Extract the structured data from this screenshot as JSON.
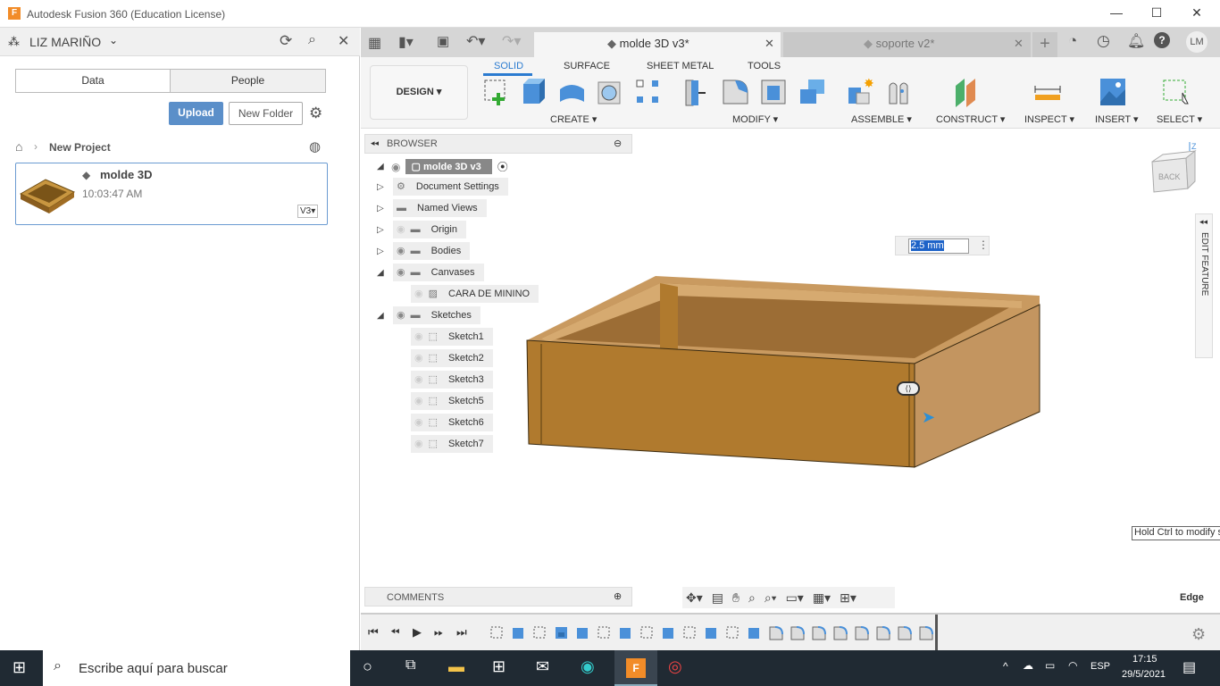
{
  "window": {
    "title": "Autodesk Fusion 360 (Education License)",
    "logo": "F",
    "controls": [
      "—",
      "☐",
      "✕"
    ]
  },
  "data_panel": {
    "user": "LIZ MARIÑO",
    "tabs": [
      "Data",
      "People"
    ],
    "upload": "Upload",
    "new_folder": "New Folder",
    "breadcrumb": "New Project",
    "file": {
      "name": "molde 3D",
      "time": "10:03:47 AM",
      "version": "V3"
    }
  },
  "tabs": [
    {
      "label": "molde 3D v3*",
      "active": true
    },
    {
      "label": "soporte v2*",
      "active": false
    }
  ],
  "user_initials": "LM",
  "ribbon": {
    "workspace": "DESIGN",
    "tabs": [
      "SOLID",
      "SURFACE",
      "SHEET METAL",
      "TOOLS"
    ],
    "active_tab": "SOLID",
    "groups": [
      "CREATE",
      "MODIFY",
      "ASSEMBLE",
      "CONSTRUCT",
      "INSPECT",
      "INSERT",
      "SELECT"
    ]
  },
  "browser": {
    "title": "BROWSER",
    "root": "molde 3D v3",
    "items": [
      {
        "label": "Document Settings",
        "icon": "gear-icon",
        "level": 1
      },
      {
        "label": "Named Views",
        "icon": "folder-icon",
        "level": 1
      },
      {
        "label": "Origin",
        "icon": "folder-icon",
        "level": 1,
        "hidden": true
      },
      {
        "label": "Bodies",
        "icon": "folder-icon",
        "level": 1
      },
      {
        "label": "Canvases",
        "icon": "folder-icon",
        "level": 1,
        "expanded": true
      },
      {
        "label": "CARA DE MININO",
        "icon": "canvas-icon",
        "level": 2,
        "hidden": true
      },
      {
        "label": "Sketches",
        "icon": "folder-icon",
        "level": 1,
        "expanded": true
      },
      {
        "label": "Sketch1",
        "icon": "sketch-icon",
        "level": 2,
        "hidden": true
      },
      {
        "label": "Sketch2",
        "icon": "sketch-icon",
        "level": 2,
        "hidden": true
      },
      {
        "label": "Sketch3",
        "icon": "sketch-icon",
        "level": 2,
        "hidden": true
      },
      {
        "label": "Sketch5",
        "icon": "sketch-icon",
        "level": 2,
        "hidden": true
      },
      {
        "label": "Sketch6",
        "icon": "sketch-icon",
        "level": 2,
        "hidden": true
      },
      {
        "label": "Sketch7",
        "icon": "sketch-icon",
        "level": 2,
        "hidden": true
      }
    ]
  },
  "viewport": {
    "dimension_input": "2.5 mm",
    "viewcube": "BACK",
    "axis": "Z",
    "edit_feature": "EDIT FEATURE",
    "tooltip": "Hold Ctrl to modify s",
    "selection": "Edge",
    "comments": "COMMENTS",
    "model_color": "#b07a2e"
  },
  "timeline": {
    "features": [
      "sketch",
      "extrude",
      "sketch",
      "canvas",
      "extrude",
      "sketch",
      "extrude",
      "sketch",
      "extrude",
      "sketch",
      "extrude",
      "sketch",
      "extrude",
      "fillet",
      "fillet",
      "fillet",
      "fillet",
      "fillet",
      "fillet",
      "fillet",
      "fillet"
    ]
  },
  "taskbar": {
    "search": "Escribe aquí para buscar",
    "lang": "ESP",
    "time": "17:15",
    "date": "29/5/2021"
  }
}
